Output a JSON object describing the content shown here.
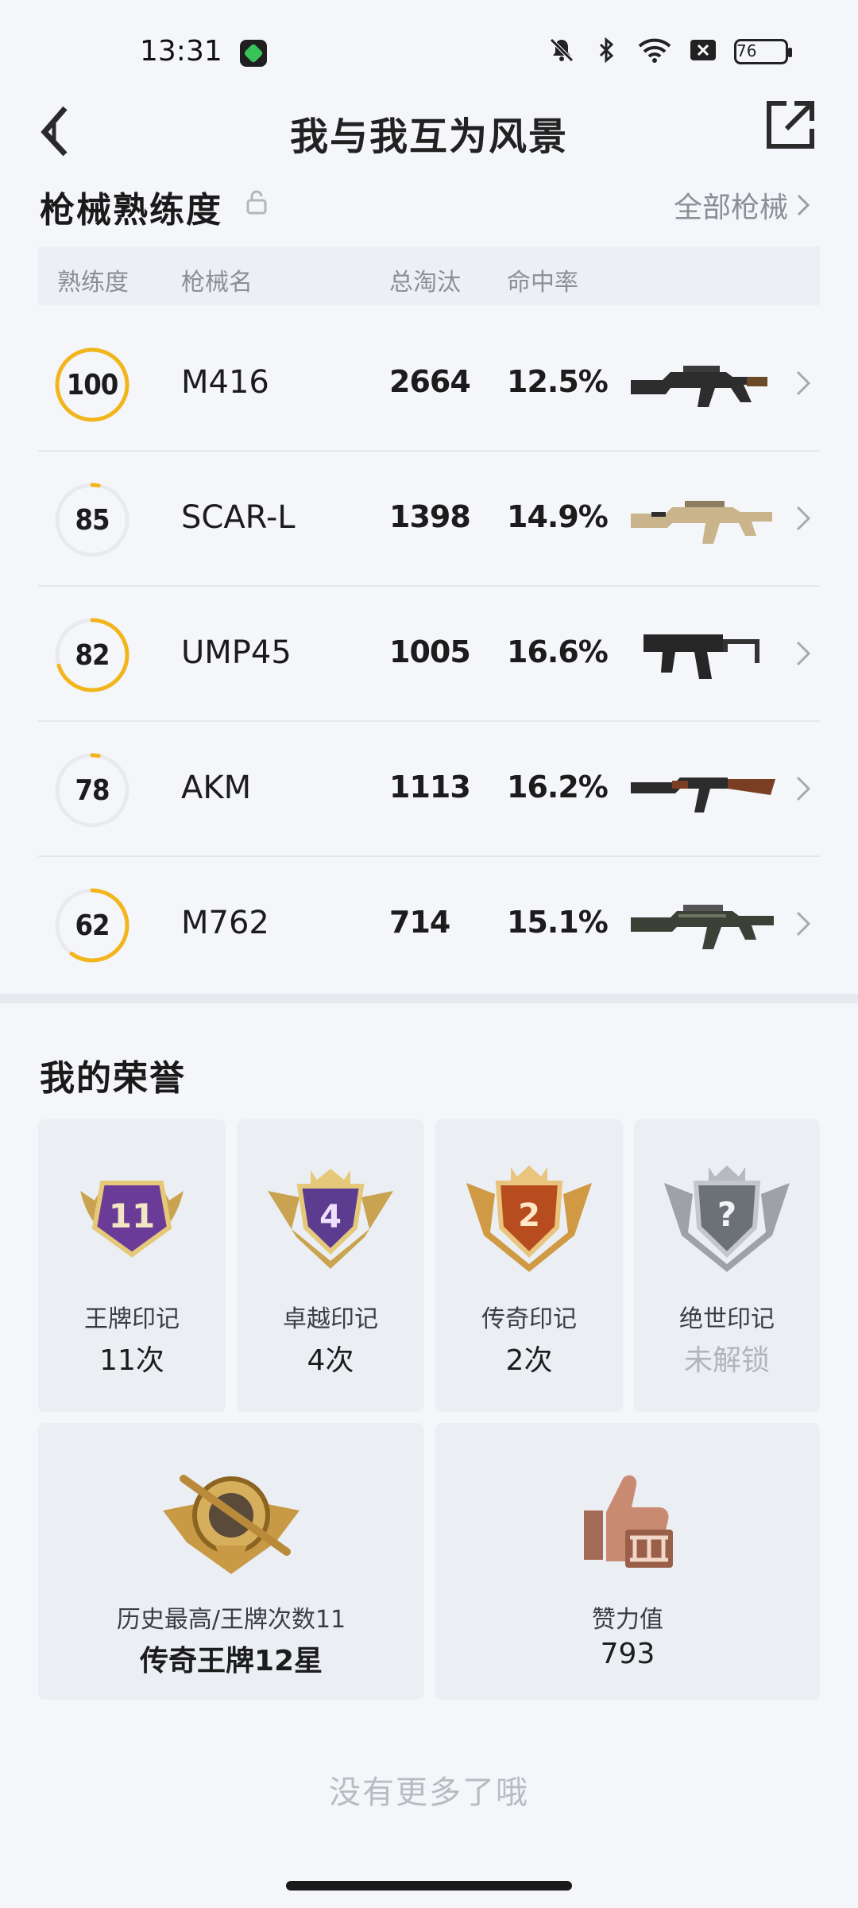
{
  "status_bar": {
    "time": "13:31",
    "battery": "76"
  },
  "header": {
    "title": "我与我互为风景"
  },
  "weapons_section": {
    "title": "枪械熟练度",
    "all_link": "全部枪械",
    "columns": [
      "熟练度",
      "枪械名",
      "总淘汰",
      "命中率"
    ],
    "rows": [
      {
        "proficiency": "100",
        "name": "M416",
        "kills": "2664",
        "hit_rate": "12.5%",
        "ring_fill": 1.0,
        "ring_color": "#f2b51c"
      },
      {
        "proficiency": "85",
        "name": "SCAR-L",
        "kills": "1398",
        "hit_rate": "14.9%",
        "ring_fill": 0.03,
        "ring_color": "#f2b51c"
      },
      {
        "proficiency": "82",
        "name": "UMP45",
        "kills": "1005",
        "hit_rate": "16.6%",
        "ring_fill": 0.7,
        "ring_color": "#f2b51c"
      },
      {
        "proficiency": "78",
        "name": "AKM",
        "kills": "1113",
        "hit_rate": "16.2%",
        "ring_fill": 0.03,
        "ring_color": "#f2b51c"
      },
      {
        "proficiency": "62",
        "name": "M762",
        "kills": "714",
        "hit_rate": "15.1%",
        "ring_fill": 0.6,
        "ring_color": "#f2b51c"
      }
    ]
  },
  "honor_section": {
    "title": "我的荣誉",
    "medals": [
      {
        "label": "王牌印记",
        "value": "11次",
        "badge": "11",
        "icon": "ace-medal-icon"
      },
      {
        "label": "卓越印记",
        "value": "4次",
        "badge": "4",
        "icon": "excellence-medal-icon"
      },
      {
        "label": "传奇印记",
        "value": "2次",
        "badge": "2",
        "icon": "legend-medal-icon"
      },
      {
        "label": "绝世印记",
        "value": "未解锁",
        "badge": "?",
        "icon": "peerless-medal-locked-icon"
      }
    ],
    "summary": [
      {
        "label": "历史最高/王牌次数11",
        "value": "传奇王牌12星",
        "icon": "rank-emblem-icon"
      },
      {
        "label": "赞力值",
        "value": "793",
        "icon": "thumbs-up-icon"
      }
    ]
  },
  "footer": {
    "note": "没有更多了哦"
  }
}
